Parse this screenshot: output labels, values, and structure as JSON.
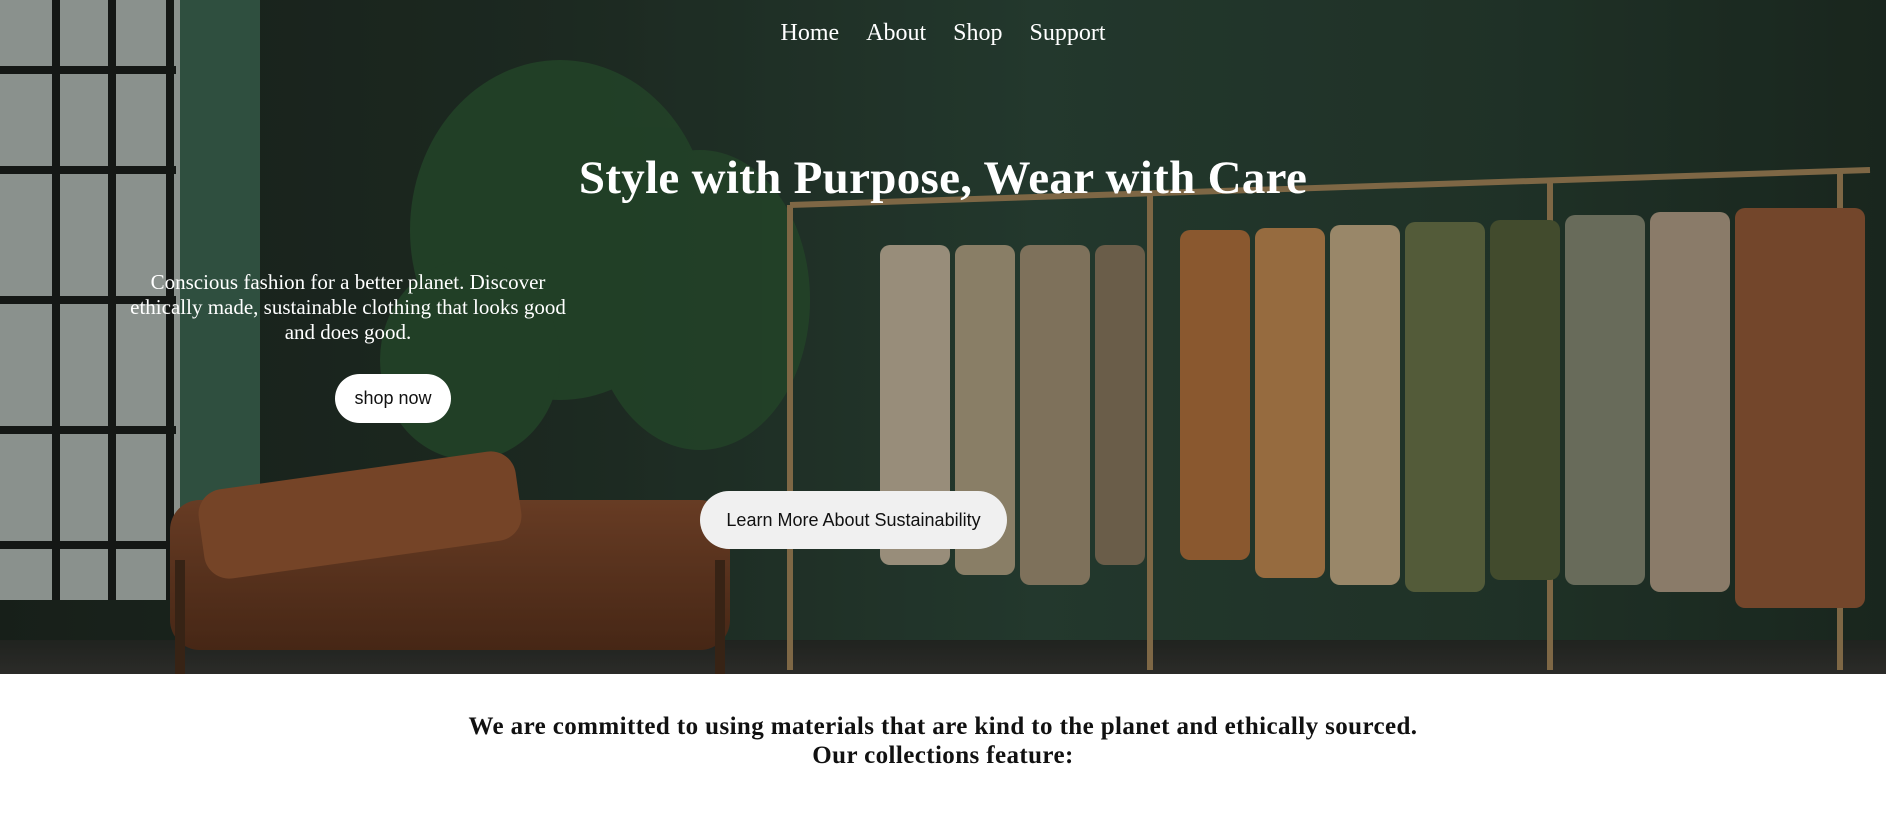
{
  "nav": {
    "items": [
      {
        "label": "Home"
      },
      {
        "label": "About"
      },
      {
        "label": "Shop"
      },
      {
        "label": "Support"
      }
    ]
  },
  "hero": {
    "title": "Style with Purpose, Wear with Care",
    "subtitle": "Conscious fashion for a better planet. Discover ethically made, sustainable clothing that looks good and does good.",
    "shop_button": "shop now",
    "learn_button": "Learn More About Sustainability"
  },
  "commitment": {
    "text": "We are committed to using materials that are kind to the planet and ethically sourced. Our collections feature:"
  },
  "colors": {
    "wall": "#2f4b3c",
    "button_bg": "#ffffff",
    "heading_text": "#111111"
  }
}
